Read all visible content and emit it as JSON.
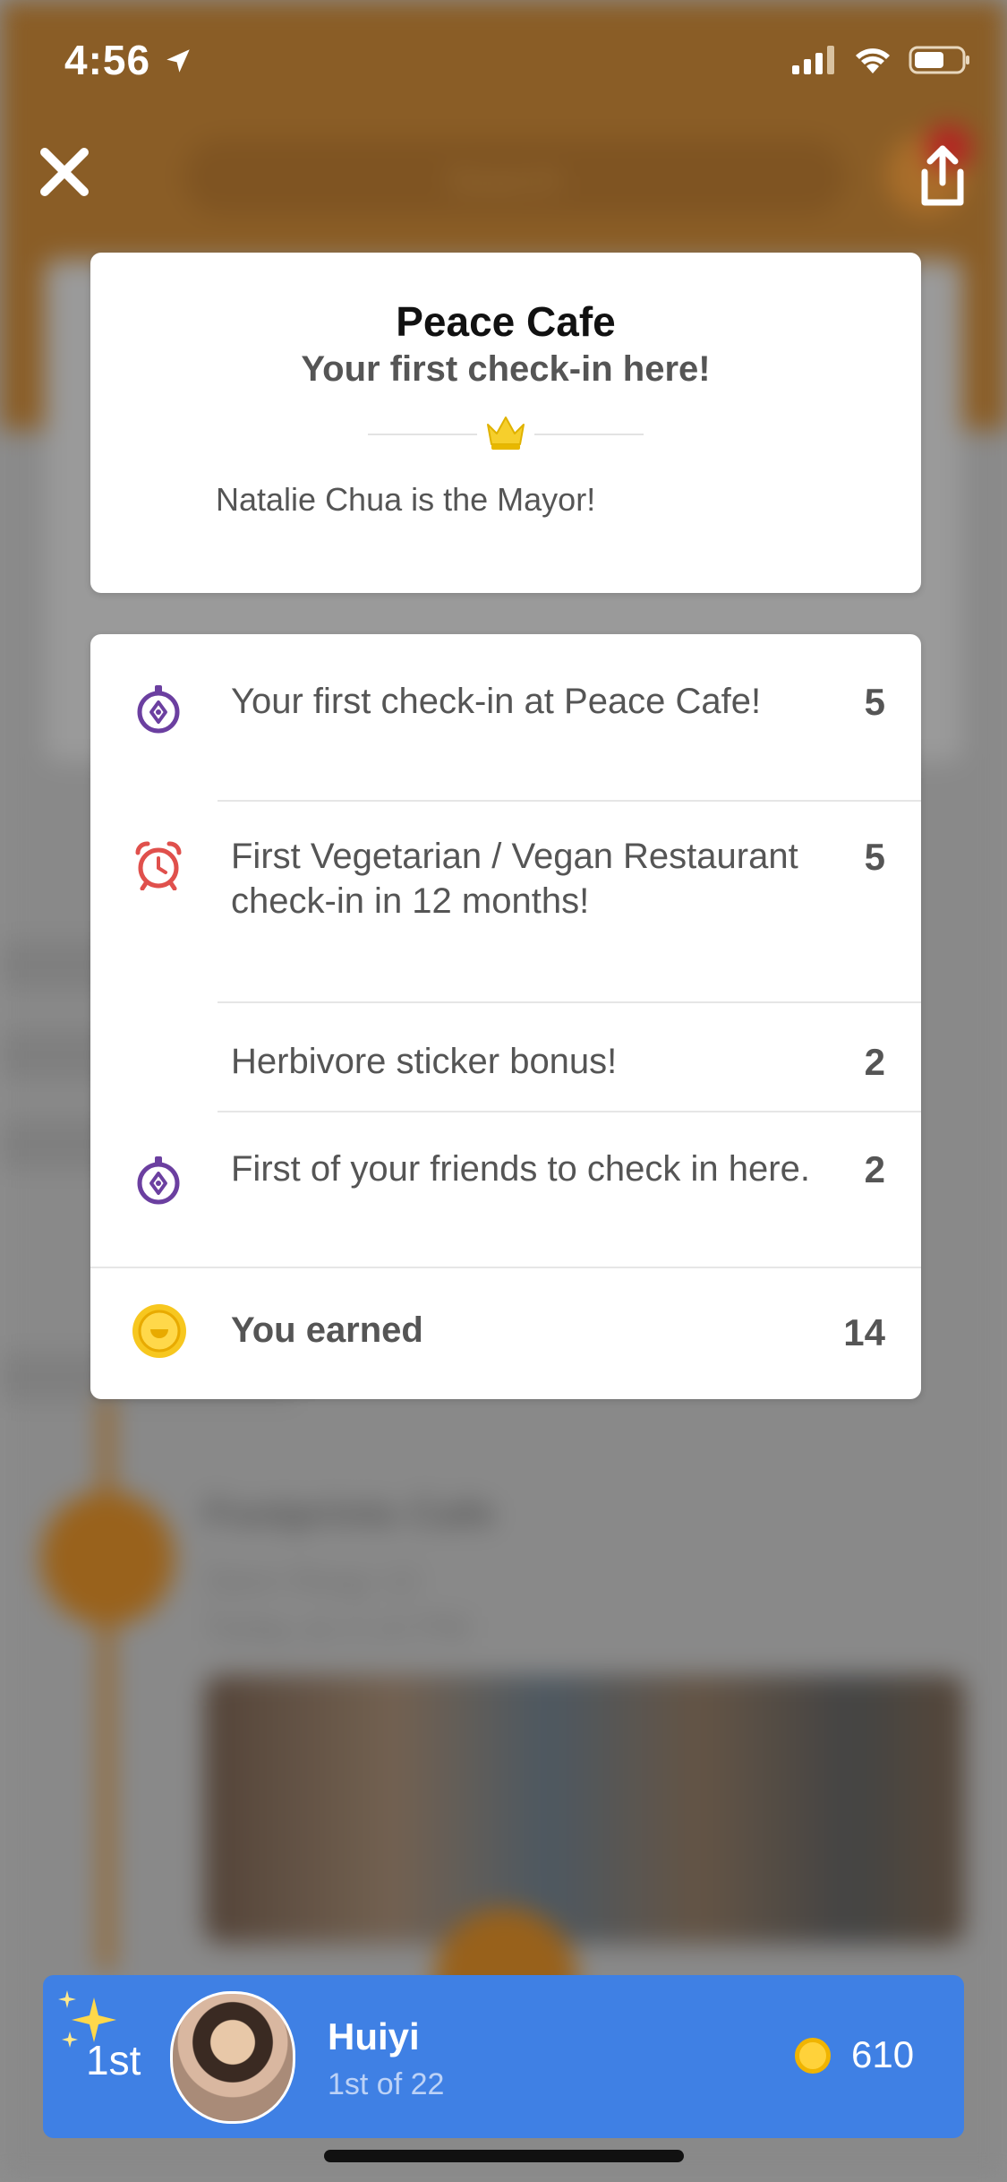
{
  "status_bar": {
    "time": "4:56"
  },
  "background": {
    "search_placeholder": "Search",
    "title": "Footprints Cafe",
    "city": "Siem Reap",
    "coins": "12",
    "when": "Today at 2:14 PM"
  },
  "venue": {
    "name": "Peace Cafe",
    "subtitle": "Your first check-in here!",
    "mayor_text": "Natalie Chua is the Mayor!"
  },
  "points": {
    "rows": [
      {
        "icon": "location-target-icon",
        "text": "Your first check-in at Peace Cafe!",
        "value": "5"
      },
      {
        "icon": "alarm-clock-icon",
        "text": "First Vegetarian / Vegan Restaurant check-in in 12 months!",
        "value": "5"
      },
      {
        "icon": "",
        "text": "Herbivore sticker bonus!",
        "value": "2"
      },
      {
        "icon": "location-target-icon",
        "text": "First of your friends to check in here.",
        "value": "2"
      }
    ],
    "total_label": "You earned",
    "total_value": "14"
  },
  "leaderboard": {
    "rank": "1st",
    "name": "Huiyi",
    "subtitle": "1st of 22",
    "coins": "610"
  },
  "colors": {
    "header_brown": "#96652a",
    "leader_blue": "#3f80e4",
    "purple_icon": "#6b3fa0",
    "red_icon": "#e0504c",
    "coin_yellow": "#ffd23a"
  }
}
